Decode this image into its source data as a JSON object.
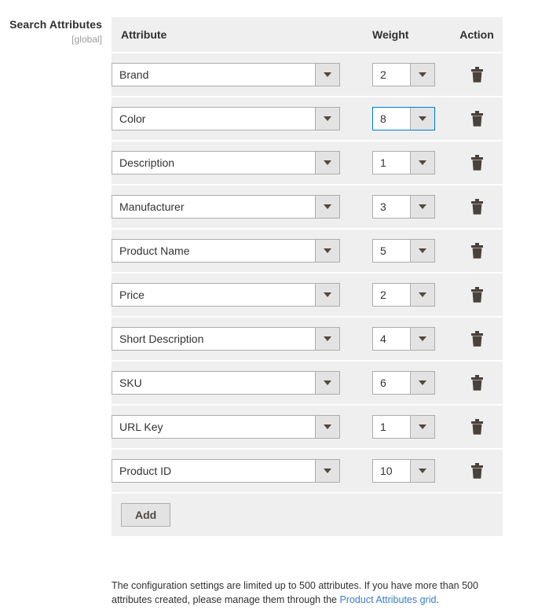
{
  "label": {
    "title": "Search Attributes",
    "scope": "[global]"
  },
  "table": {
    "headers": {
      "attribute": "Attribute",
      "weight": "Weight",
      "action": "Action"
    },
    "rows": [
      {
        "attribute": "Brand",
        "weight": "2",
        "focused": false,
        "delete_icon": "trash-icon"
      },
      {
        "attribute": "Color",
        "weight": "8",
        "focused": true,
        "delete_icon": "trash-icon"
      },
      {
        "attribute": "Description",
        "weight": "1",
        "focused": false,
        "delete_icon": "trash-icon"
      },
      {
        "attribute": "Manufacturer",
        "weight": "3",
        "focused": false,
        "delete_icon": "trash-icon"
      },
      {
        "attribute": "Product Name",
        "weight": "5",
        "focused": false,
        "delete_icon": "trash-icon"
      },
      {
        "attribute": "Price",
        "weight": "2",
        "focused": false,
        "delete_icon": "trash-icon"
      },
      {
        "attribute": "Short Description",
        "weight": "4",
        "focused": false,
        "delete_icon": "trash-icon"
      },
      {
        "attribute": "SKU",
        "weight": "6",
        "focused": false,
        "delete_icon": "trash-icon"
      },
      {
        "attribute": "URL Key",
        "weight": "1",
        "focused": false,
        "delete_icon": "trash-icon"
      },
      {
        "attribute": "Product ID",
        "weight": "10",
        "focused": false,
        "delete_icon": "trash-icon"
      }
    ],
    "add_label": "Add"
  },
  "note": {
    "text_before": "The configuration settings are limited up to 500 attributes. If you have more than 500 attributes created, please manage them through the ",
    "link_text": "Product Attributes grid",
    "text_after": "."
  },
  "colors": {
    "row_background": "#efefef",
    "focus_border": "#007bdb",
    "link": "#3b7cc4",
    "text": "#303030",
    "scope_text": "#9b9b9b",
    "control_border": "#adadad",
    "arrow_button": "#e3e3e3",
    "trash": "#4a423c"
  }
}
